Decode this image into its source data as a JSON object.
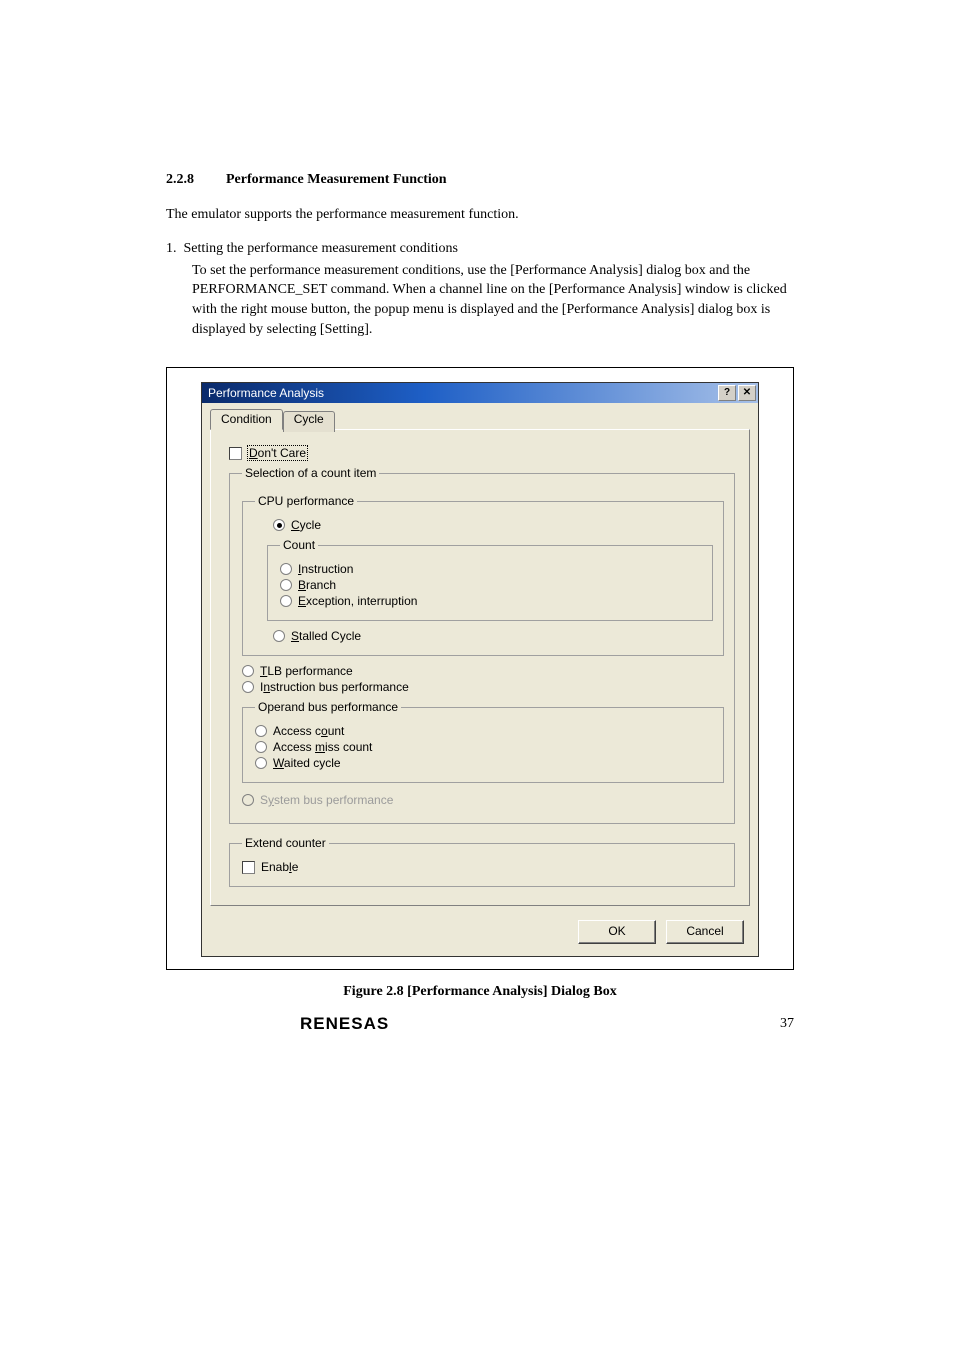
{
  "section": {
    "number": "2.2.8",
    "title": "Performance Measurement Function"
  },
  "para1": "The emulator supports the performance measurement function.",
  "list": {
    "num": "1.",
    "head": "Setting the performance measurement conditions",
    "body": "To set the performance measurement conditions, use the [Performance Analysis] dialog box and the PERFORMANCE_SET command.  When a channel line on the [Performance Analysis] window is clicked with the right mouse button, the popup menu is displayed and the [Performance Analysis] dialog box is displayed by selecting [Setting]."
  },
  "dialog": {
    "title": "Performance Analysis",
    "help_btn": "?",
    "close_btn": "✕",
    "tabs": [
      "Condition",
      "Cycle"
    ],
    "dont_care": "Don't Care",
    "group_selection": "Selection of a count item",
    "group_cpu": "CPU performance",
    "radio_cycle": "Cycle",
    "group_count": "Count",
    "radio_instruction": "Instruction",
    "radio_branch": "Branch",
    "radio_exception": "Exception, interruption",
    "radio_stalled": "Stalled Cycle",
    "radio_tlb": "TLB performance",
    "radio_instr_bus": "Instruction bus performance",
    "group_operand": "Operand bus performance",
    "radio_access_count": "Access count",
    "radio_access_miss": "Access miss count",
    "radio_waited": "Waited cycle",
    "radio_system_bus": "System bus performance",
    "group_extend": "Extend counter",
    "chk_enable": "Enable",
    "ok": "OK",
    "cancel": "Cancel"
  },
  "caption": "Figure 2.8   [Performance Analysis] Dialog Box",
  "footer": {
    "logo": "RENESAS",
    "page": "37"
  }
}
